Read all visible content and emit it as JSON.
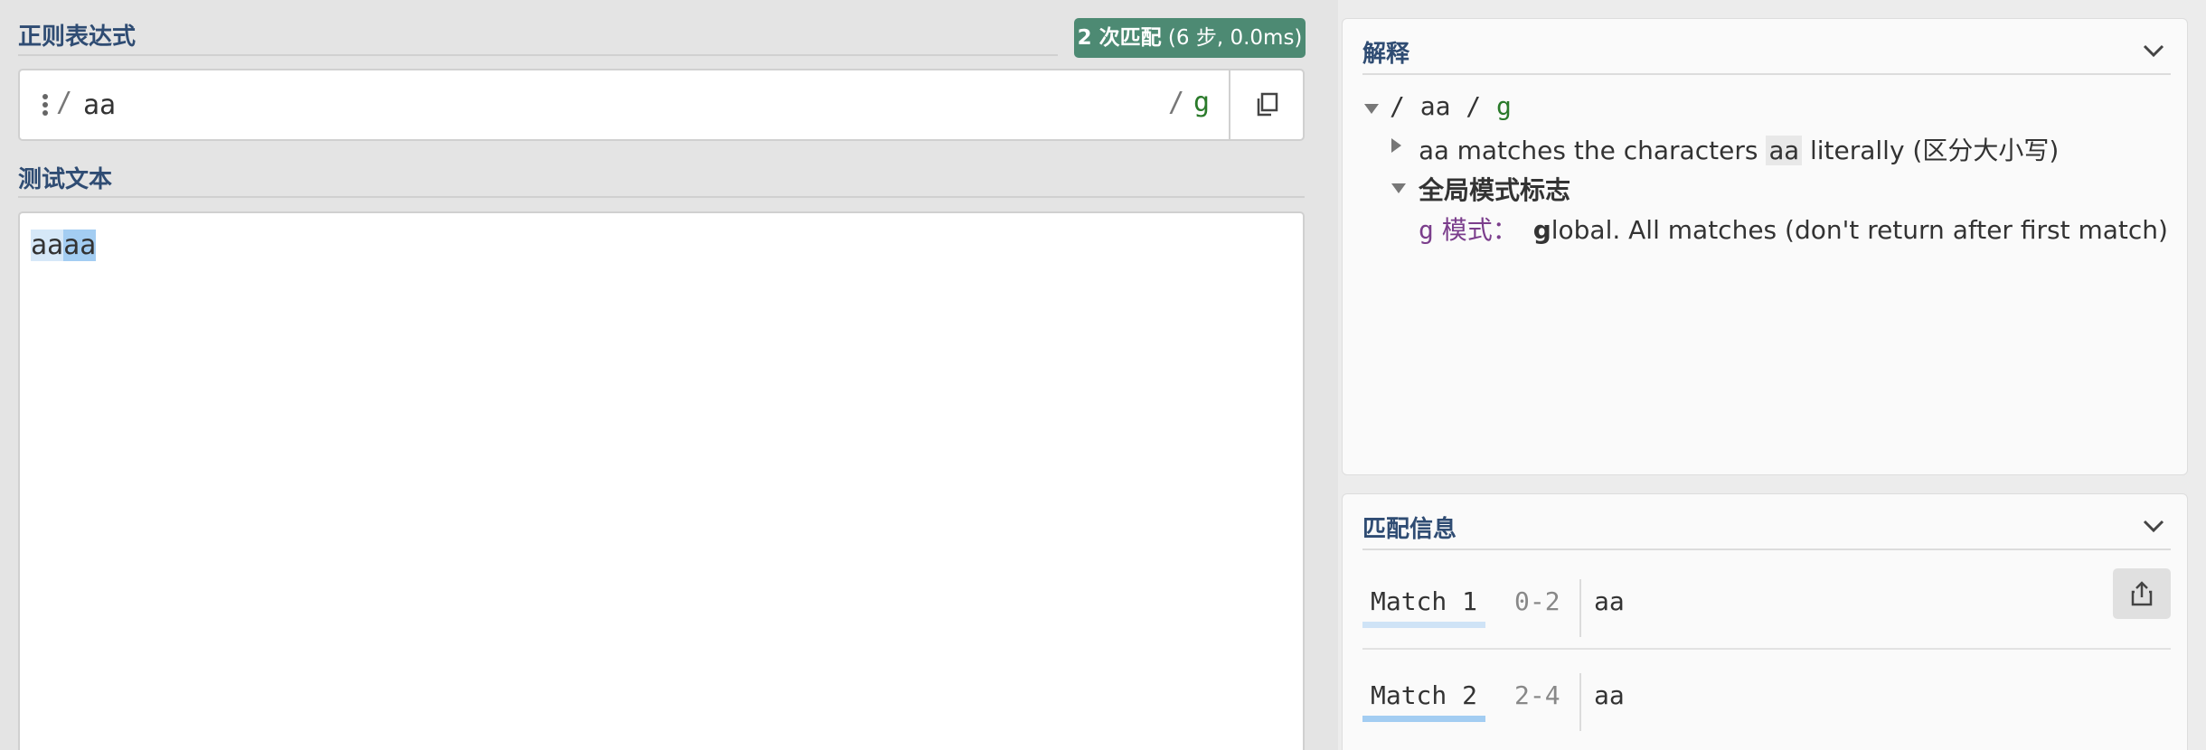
{
  "regex_section": {
    "title": "正则表达式",
    "badge_count": "2 次匹配",
    "badge_detail": "(6 步, 0.0ms)",
    "open_delim": "/",
    "pattern": "aa",
    "close_delim": "/",
    "flags": "g"
  },
  "test_section": {
    "title": "测试文本",
    "segments": [
      {
        "text": "aa",
        "match": 1
      },
      {
        "text": "aa",
        "match": 2
      }
    ]
  },
  "explanation": {
    "title": "解释",
    "root": {
      "open": "/",
      "pattern": "aa",
      "close": "/",
      "flags": "g"
    },
    "token_row": {
      "token": "aa",
      "text_before": "matches the characters",
      "chip": "aa",
      "text_after": "literally (区分大小写)"
    },
    "flags_heading": "全局模式标志",
    "flag_row": {
      "flag": "g",
      "mode_label": "模式：",
      "flag_letter": "g",
      "description": "lobal. All matches (don't return after first match)"
    }
  },
  "match_info": {
    "title": "匹配信息",
    "matches": [
      {
        "label": "Match 1",
        "range": "0-2",
        "value": "aa"
      },
      {
        "label": "Match 2",
        "range": "2-4",
        "value": "aa"
      }
    ]
  },
  "icons": {
    "copy": "copy-icon",
    "drag": "drag-handle-icon",
    "chevron": "chevron-down-icon",
    "share": "share-icon"
  },
  "colors": {
    "badge_bg": "#4d8a73",
    "section_title": "#2f4c73",
    "match1_highlight": "#d6e8f8",
    "match2_highlight": "#a3cdf2",
    "flag_color": "#2a7a2a"
  }
}
